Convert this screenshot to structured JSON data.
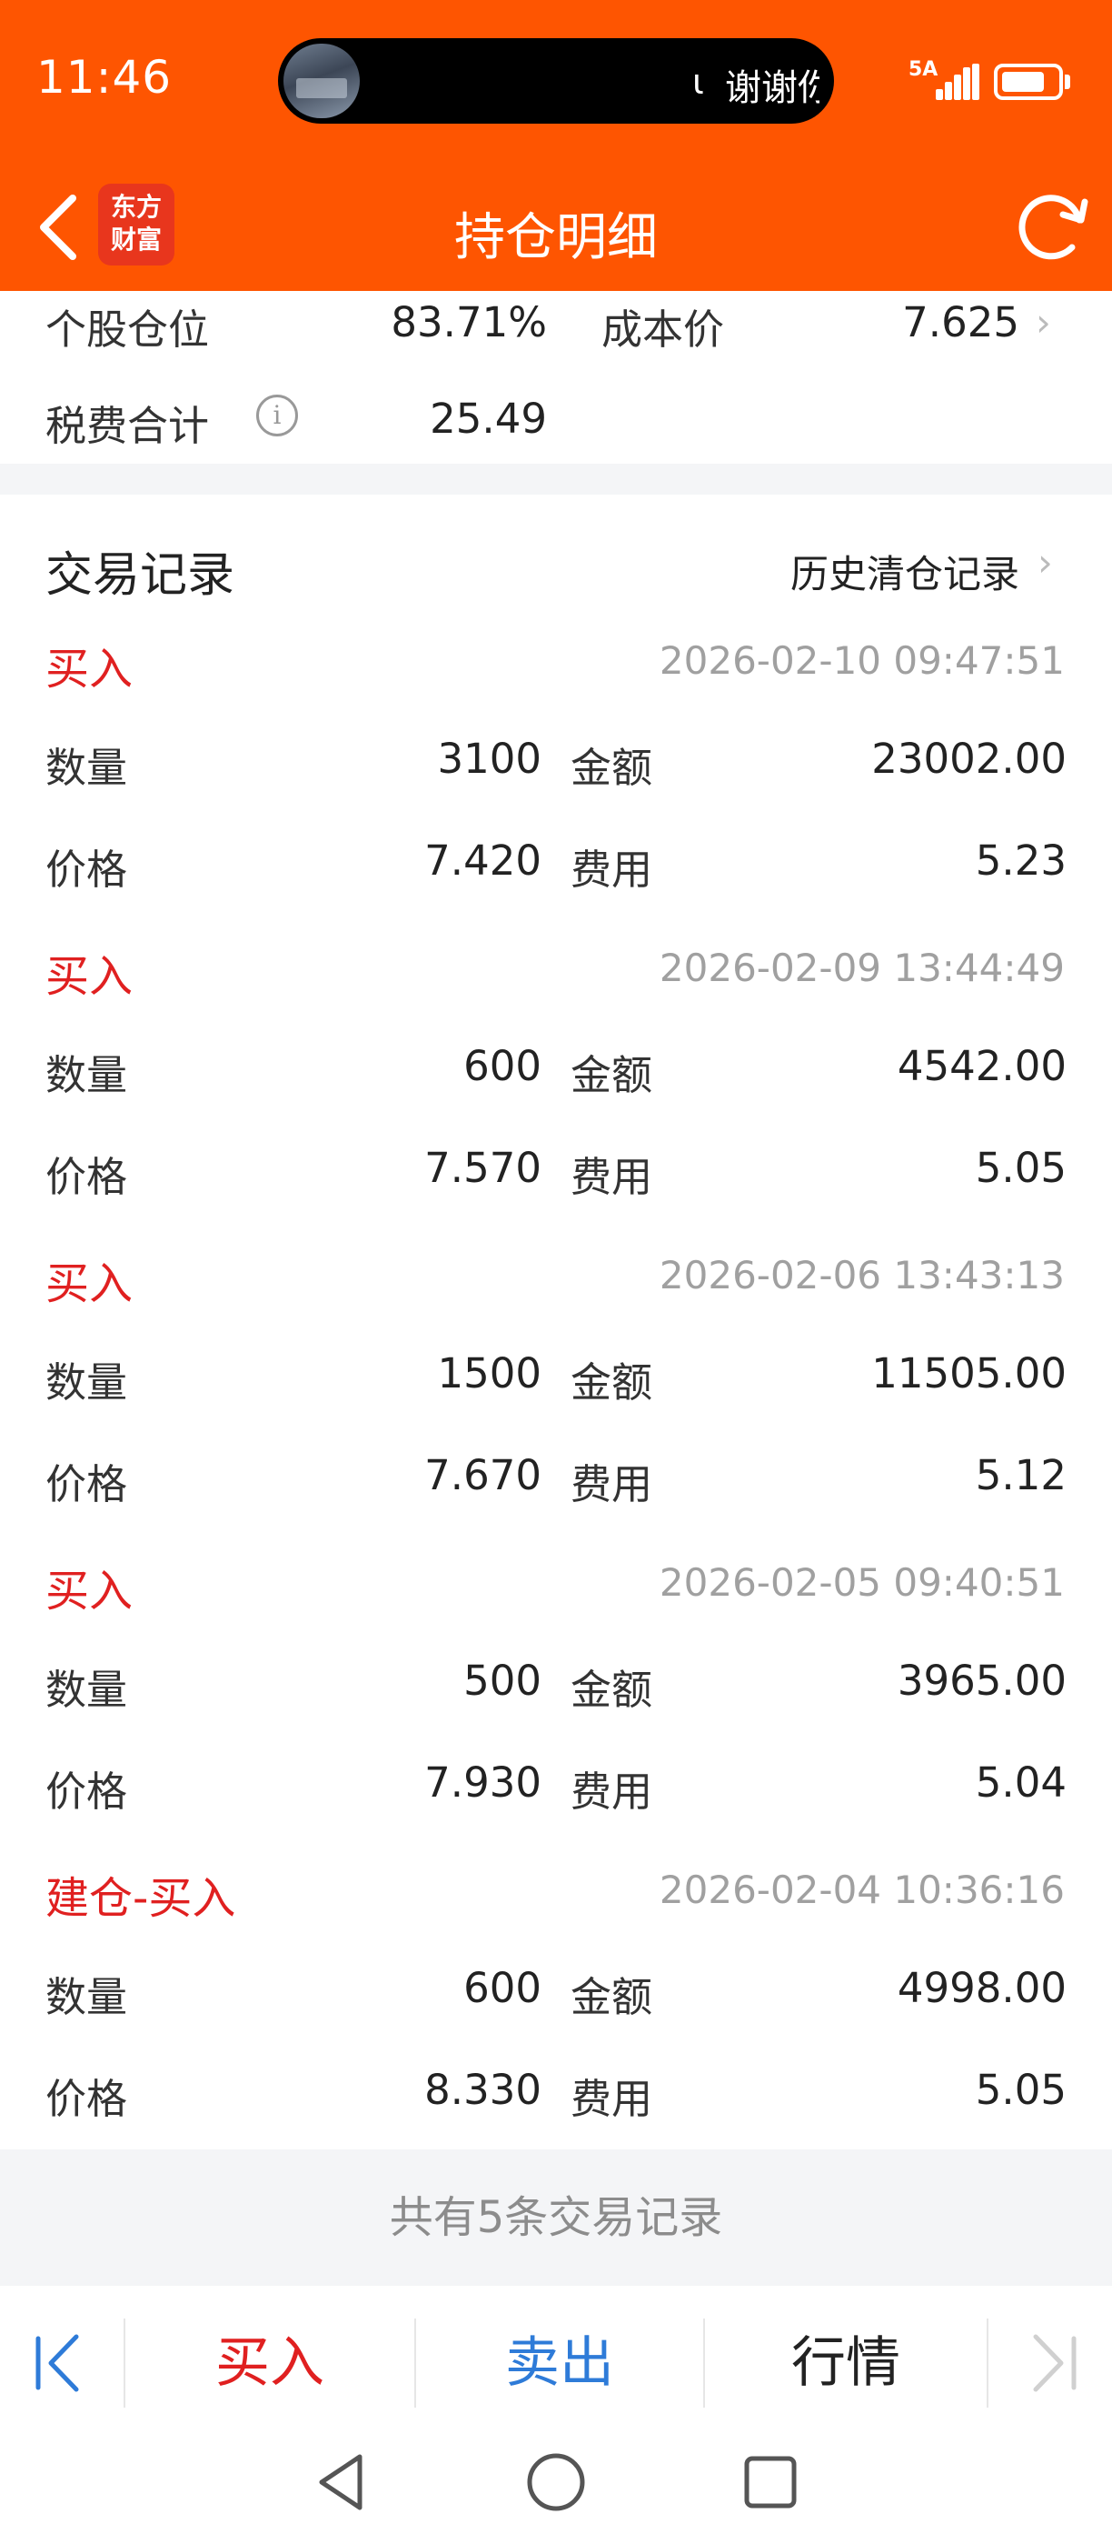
{
  "status_bar": {
    "time": "11:46",
    "island_text": "谢谢你",
    "network_label": "5A",
    "battery_level": 0.8
  },
  "header": {
    "title": "持仓明细",
    "logo_line1": "东方",
    "logo_line2": "财富",
    "back_icon": "chevron-left-icon",
    "refresh_icon": "refresh-icon"
  },
  "summary": {
    "position_label": "个股仓位",
    "position_value": "83.71%",
    "cost_label": "成本价",
    "cost_value": "7.625",
    "fee_label": "税费合计",
    "fee_value": "25.49"
  },
  "records": {
    "title": "交易记录",
    "history_link": "历史清仓记录",
    "qty_label": "数量",
    "amount_label": "金额",
    "price_label": "价格",
    "fee_label": "费用",
    "trades": [
      {
        "type": "买入",
        "time": "2026-02-10 09:47:51",
        "qty": "3100",
        "amount": "23002.00",
        "price": "7.420",
        "fee": "5.23"
      },
      {
        "type": "买入",
        "time": "2026-02-09 13:44:49",
        "qty": "600",
        "amount": "4542.00",
        "price": "7.570",
        "fee": "5.05"
      },
      {
        "type": "买入",
        "time": "2026-02-06 13:43:13",
        "qty": "1500",
        "amount": "11505.00",
        "price": "7.670",
        "fee": "5.12"
      },
      {
        "type": "买入",
        "time": "2026-02-05 09:40:51",
        "qty": "500",
        "amount": "3965.00",
        "price": "7.930",
        "fee": "5.04"
      },
      {
        "type": "建仓-买入",
        "time": "2026-02-04 10:36:16",
        "qty": "600",
        "amount": "4998.00",
        "price": "8.330",
        "fee": "5.05"
      }
    ],
    "footer_note": "共有5条交易记录"
  },
  "action_bar": {
    "buy": "买入",
    "sell": "卖出",
    "quote": "行情"
  },
  "colors": {
    "brand_orange": "#FE5501",
    "buy_red": "#E02020",
    "sell_blue": "#2E7BD8"
  }
}
